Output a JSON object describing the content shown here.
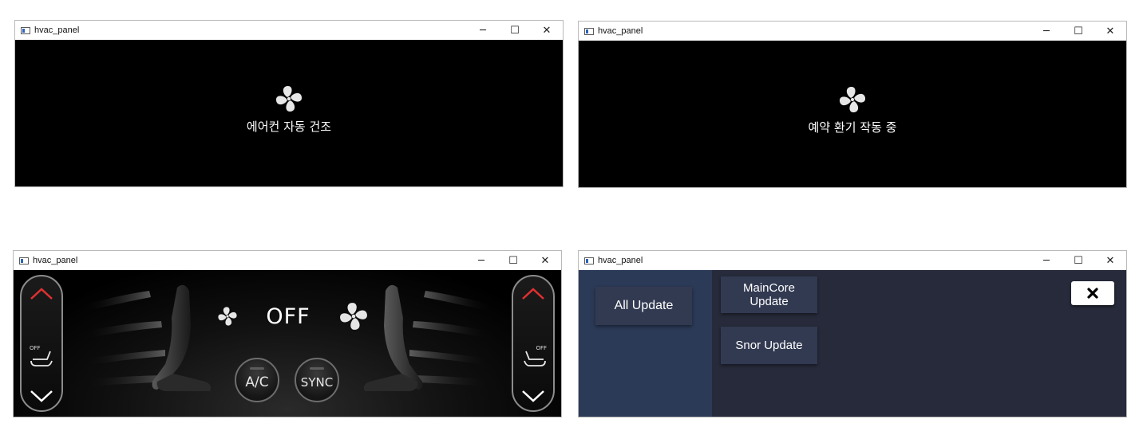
{
  "windows": [
    {
      "title": "hvac_panel",
      "controls": {
        "minimize": "─",
        "maximize": "☐",
        "close": "✕"
      },
      "fan_icon": "fan-icon",
      "message": "에어컨 자동 건조"
    },
    {
      "title": "hvac_panel",
      "controls": {
        "minimize": "─",
        "maximize": "☐",
        "close": "✕"
      },
      "fan_icon": "fan-icon",
      "message": "예약 환기 작동 중"
    },
    {
      "title": "hvac_panel",
      "controls": {
        "minimize": "─",
        "maximize": "☐",
        "close": "✕"
      },
      "fan_status": "OFF",
      "left_seat": {
        "label": "OFF",
        "up_icon": "chevron-up-icon",
        "down_icon": "chevron-down-icon",
        "up_color": "#e03030"
      },
      "right_seat": {
        "label": "OFF",
        "up_icon": "chevron-up-icon",
        "down_icon": "chevron-down-icon",
        "up_color": "#e03030"
      },
      "buttons": {
        "ac": "A/C",
        "sync": "SYNC"
      }
    },
    {
      "title": "hvac_panel",
      "controls": {
        "minimize": "─",
        "maximize": "☐",
        "close": "✕"
      },
      "all_update": "All Update",
      "maincore_update": "MainCore\nUpdate",
      "snor_update": "Snor Update",
      "close_icon": "close-icon",
      "colors": {
        "sidebar": "#2b3a57",
        "panel": "#262a3a",
        "button": "#323a52"
      }
    }
  ]
}
